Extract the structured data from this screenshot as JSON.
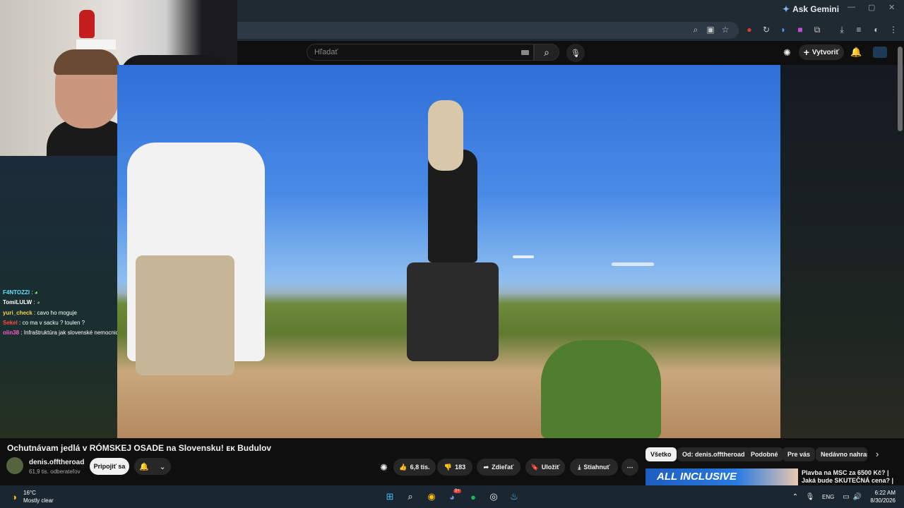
{
  "browser": {
    "ask_gemini": "Ask Gemini",
    "window_controls": [
      "—",
      "▢",
      "✕"
    ]
  },
  "youtube": {
    "search_placeholder": "Hľadať",
    "create_label": "Vytvoriť"
  },
  "chat": [
    {
      "user": "F4NTOZZI",
      "text": ":",
      "color": "#5ee0ff"
    },
    {
      "user": "TomiLULW",
      "text": ":",
      "color": "#ffffff"
    },
    {
      "user": "yuri_check",
      "text": ": cavo ho moguje",
      "color": "#f7d14a"
    },
    {
      "user": "Sekel",
      "text": ": co ma v sacku ? toulen ?",
      "color": "#ff4a4a"
    },
    {
      "user": "olin38",
      "text": ": Infraštruktúra jak slovenské nemocnice",
      "color": "#ff5ad1"
    }
  ],
  "video": {
    "title": "Ochutnávam jedlá v RÓMSKEJ OSADE na Slovensku! ᴇᴋ Budulov",
    "channel": "denis.offtheroad",
    "subscribers": "61,9 tis. odberateľov",
    "join_label": "Pripojiť sa",
    "likes": "6,8 tis.",
    "dislikes": "183",
    "share_label": "Zdieľať",
    "save_label": "Uložiť",
    "download_label": "Stiahnuť"
  },
  "chips": [
    "Všetko",
    "Od: denis.offtheroad",
    "Podobné",
    "Pre vás",
    "Nedávno nahrané"
  ],
  "recommendation": {
    "thumb_text": "ALL INCLUSIVE",
    "title_line1": "Plavba na MSC za 6500 Kč? |",
    "title_line2": "Jaká bude SKUTEČNÁ cena? |"
  },
  "taskbar": {
    "temperature": "16°C",
    "weather": "Mostly clear",
    "language": "ENG",
    "time": "6:22 AM",
    "date": "8/30/2026",
    "discord_badge": "9+"
  },
  "colors": {
    "accent": "#f1f1f1",
    "taskbar": "#1b2730",
    "chrome": "#1f2a33"
  }
}
